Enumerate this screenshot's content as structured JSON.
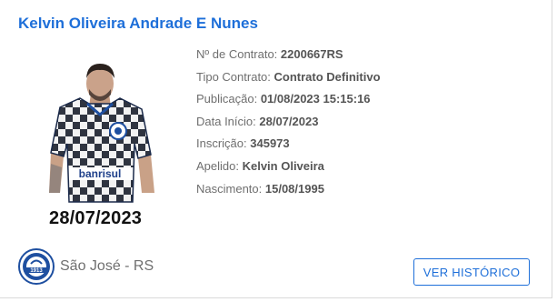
{
  "player": {
    "name": "Kelvin Oliveira Andrade E Nunes",
    "photo_caption": "28/07/2023",
    "shirt_sponsor": "banrisul"
  },
  "details": [
    {
      "label": "Nº de Contrato: ",
      "value": "2200667RS"
    },
    {
      "label": "Tipo Contrato: ",
      "value": "Contrato Definitivo"
    },
    {
      "label": "Publicação: ",
      "value": "01/08/2023 15:15:16"
    },
    {
      "label": "Data Início: ",
      "value": "28/07/2023"
    },
    {
      "label": "Inscrição: ",
      "value": "345973"
    },
    {
      "label": "Apelido: ",
      "value": "Kelvin Oliveira"
    },
    {
      "label": "Nascimento: ",
      "value": "15/08/1995"
    }
  ],
  "club": {
    "name": "São José - RS",
    "logo_icon": "club-crest-icon",
    "logo_text": "1913"
  },
  "actions": {
    "history_label": "VER HISTÓRICO"
  },
  "colors": {
    "accent": "#1e6fd9",
    "label": "#6f6f6f",
    "value": "#555555"
  }
}
